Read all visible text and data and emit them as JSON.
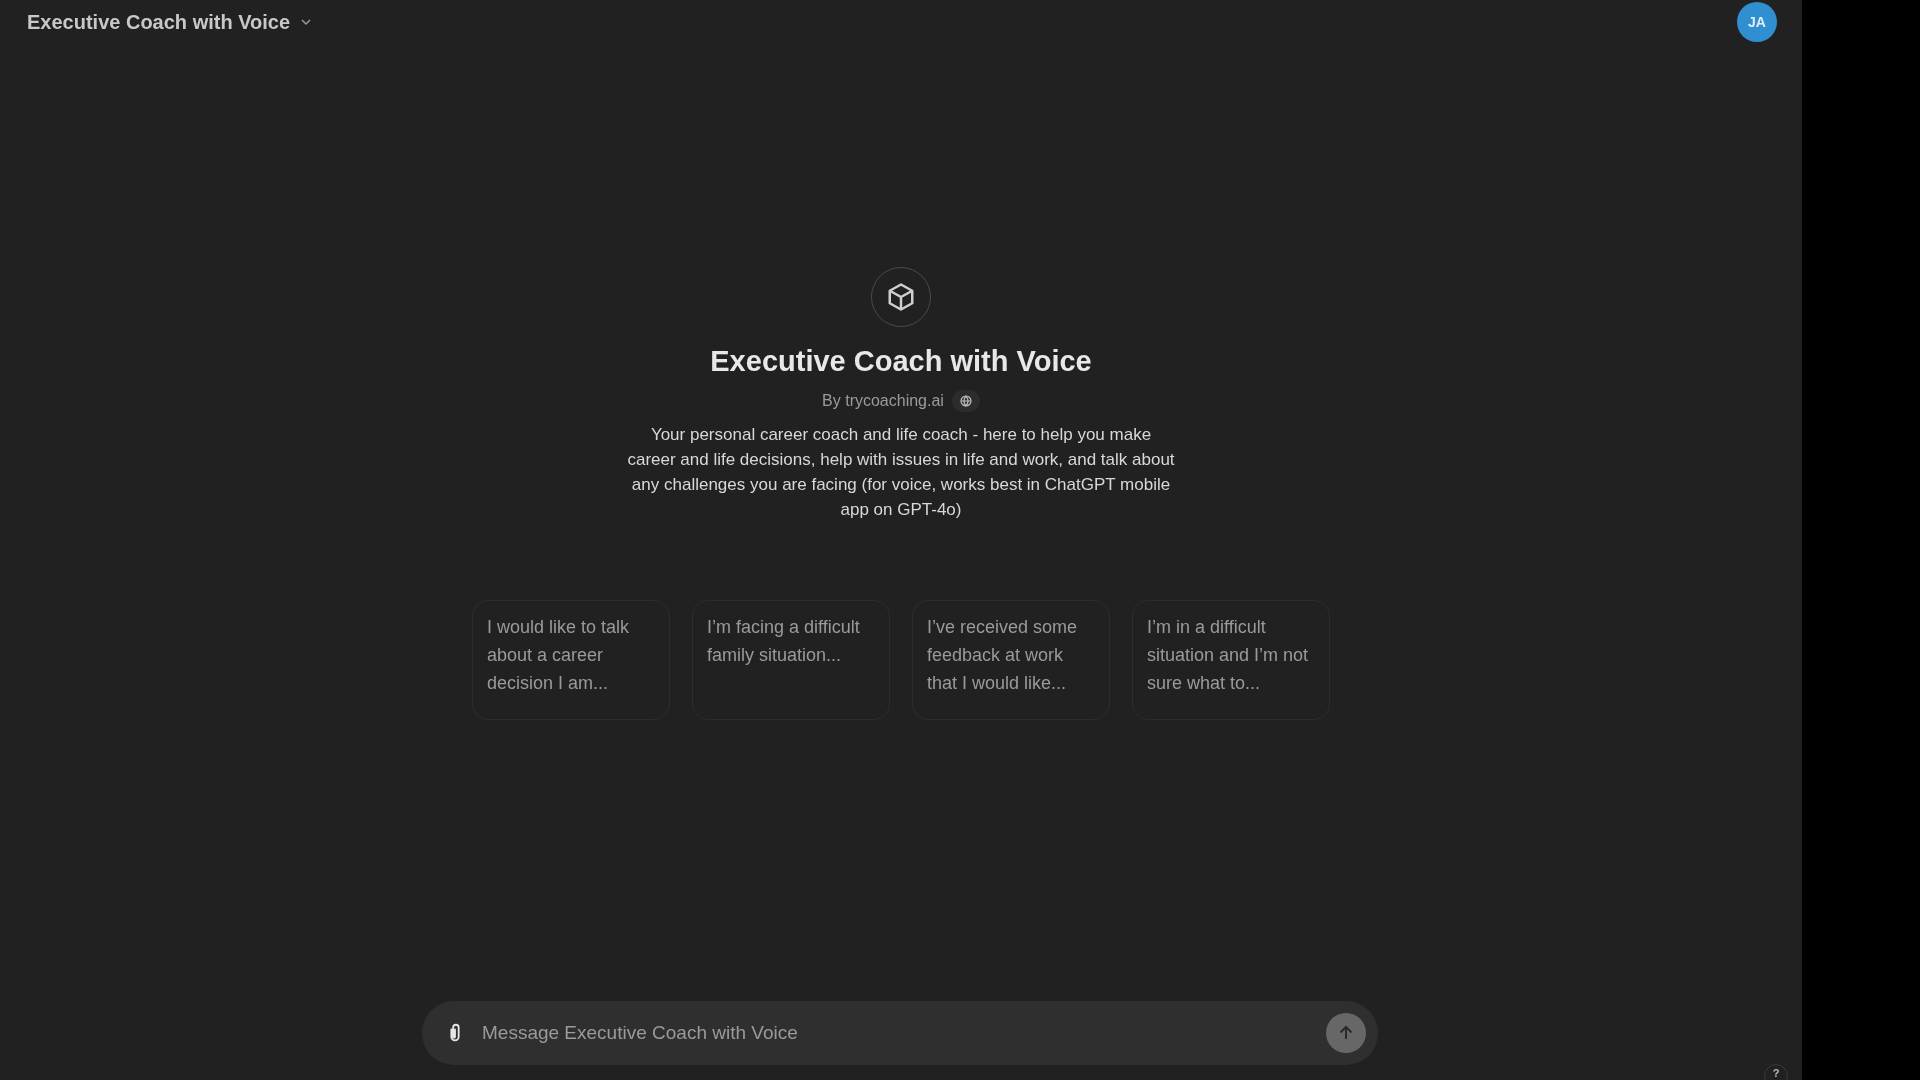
{
  "header": {
    "title": "Executive Coach with Voice",
    "avatar": "JA"
  },
  "gpt": {
    "name": "Executive Coach with Voice",
    "author": "By trycoaching.ai",
    "description": "Your personal career coach and life coach - here to help you make career and life decisions, help with issues in life and work, and talk about any challenges you are facing (for voice, works best in ChatGPT mobile app on GPT-4o)"
  },
  "suggestions": [
    {
      "text": "I would like to talk about a career decision I am..."
    },
    {
      "text": "I’m facing a difficult family situation..."
    },
    {
      "text": "I’ve received some feedback at work that I would like..."
    },
    {
      "text": "I’m in a difficult situation and I’m not sure what to..."
    }
  ],
  "composer": {
    "placeholder": "Message Executive Coach with Voice"
  },
  "help": "?"
}
